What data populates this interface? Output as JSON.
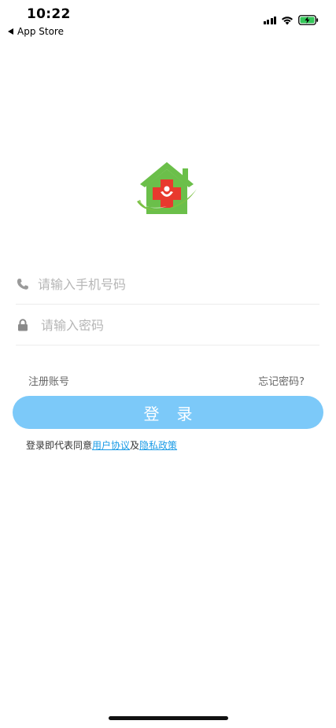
{
  "status_bar": {
    "time": "10:22",
    "back_label": "App Store"
  },
  "form": {
    "phone_placeholder": "请输入手机号码",
    "password_placeholder": "请输入密码"
  },
  "links": {
    "register": "注册账号",
    "forgot": "忘记密码?"
  },
  "login_button": "登录",
  "agreement": {
    "prefix": "登录即代表同意",
    "user_agreement": "用户协议",
    "and": "及",
    "privacy_policy": "隐私政策"
  },
  "colors": {
    "accent": "#7cc9f9",
    "link": "#1a9be6",
    "logo_green": "#6bbf4a",
    "logo_red": "#e8392e"
  },
  "icons": {
    "phone": "phone-icon",
    "lock": "lock-icon",
    "logo": "medical-home-logo-icon"
  }
}
